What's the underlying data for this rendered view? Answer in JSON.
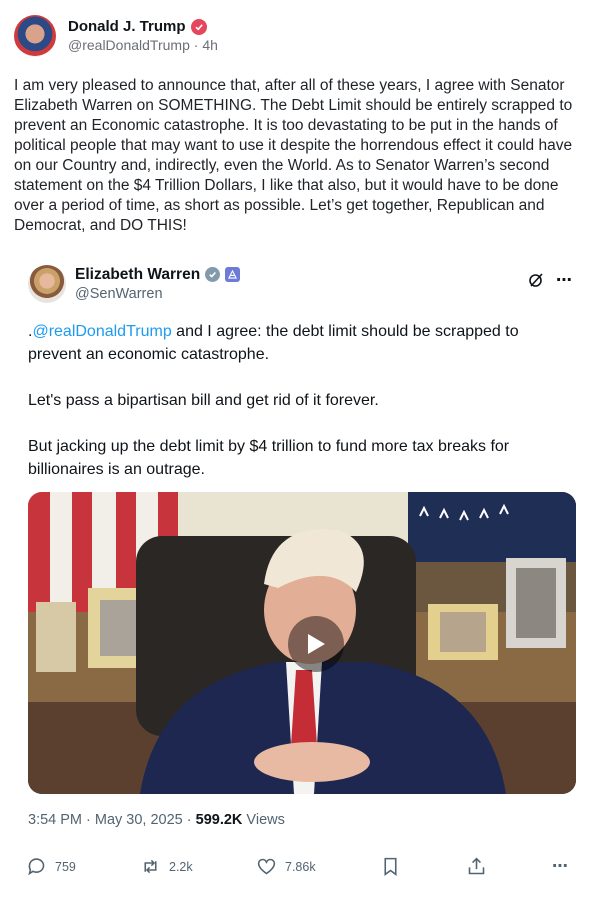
{
  "author": {
    "name": "Donald J. Trump",
    "handle": "@realDonaldTrump",
    "separator": " · ",
    "time": "4h"
  },
  "post_text": "I am very pleased to announce that, after all of these years, I agree with Senator Elizabeth Warren on SOMETHING. The Debt Limit should be entirely scrapped to prevent an Economic catastrophe. It is too devastating to be put in the hands of political people that may want to use it despite the horrendous effect it could have on our Country and, indirectly, even the World. As to Senator Warren’s second statement on the $4 Trillion Dollars, I like that also, but it would have to be done over a period of time, as short as possible. Let’s get together, Republican and Democrat, and DO THIS!",
  "quoted": {
    "name": "Elizabeth Warren",
    "handle": "@SenWarren",
    "paragraphs": {
      "p1_prefix": ".",
      "p1_mention": "@realDonaldTrump",
      "p1_rest": " and I agree: the debt limit should be scrapped to prevent an economic catastrophe.",
      "p2": "Let's pass a bipartisan bill and get rid of it forever.",
      "p3": "But jacking up the debt limit by $4 trillion to fund more tax breaks for billionaires is an outrage."
    },
    "timestamp": "3:54 PM · May 30, 2025 · ",
    "views_count": "599.2K",
    "views_label": " Views"
  },
  "actions": {
    "replies": "759",
    "reposts": "2.2k",
    "likes": "7.86k"
  },
  "colors": {
    "mention": "#1d9bf0",
    "verified_badge": "#e6455c",
    "muted_text": "#536471"
  }
}
